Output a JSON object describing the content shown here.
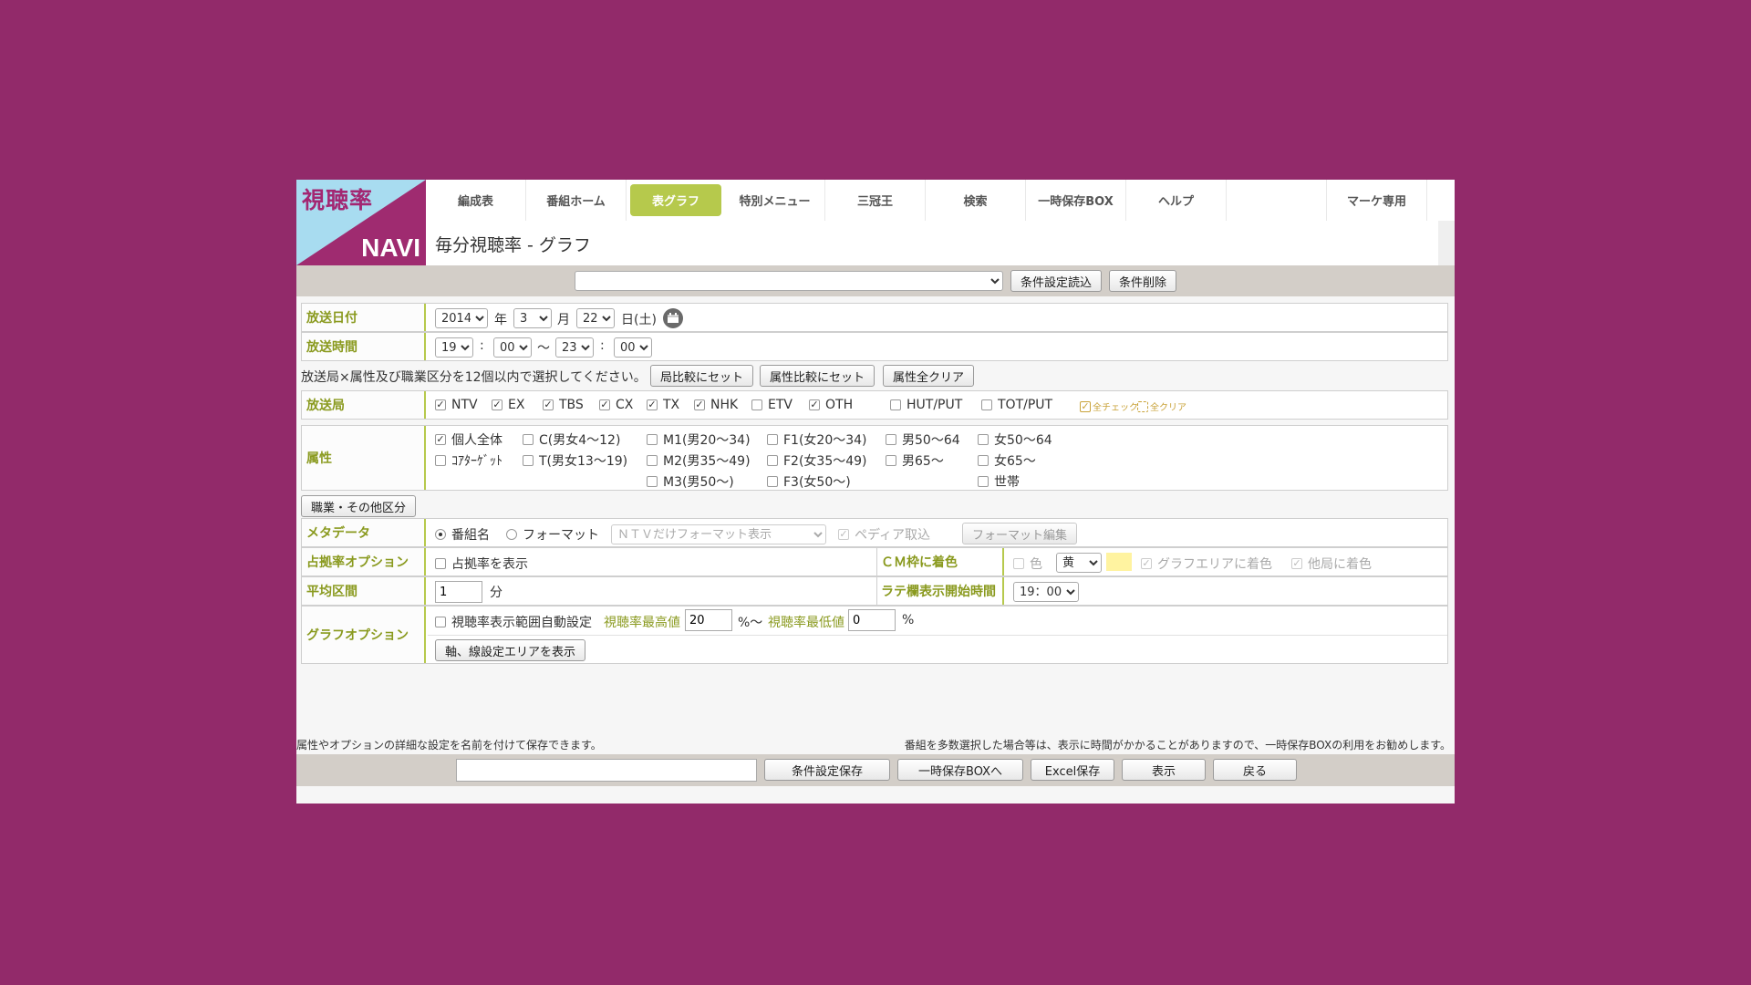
{
  "logo": {
    "top": "視聴率",
    "bottom": "NAVI"
  },
  "nav": {
    "items": [
      "編成表",
      "番組ホーム",
      "表グラフ",
      "特別メニュー",
      "三冠王",
      "検索",
      "一時保存BOX",
      "ヘルプ"
    ],
    "right": "マーケ専用",
    "active_index": 2
  },
  "page_title": "毎分視聴率 - グラフ",
  "condition": {
    "select_value": "",
    "load_label": "条件設定読込",
    "delete_label": "条件削除"
  },
  "date": {
    "label": "放送日付",
    "year": "2014",
    "year_unit": "年",
    "month": "3",
    "month_unit": "月",
    "day": "22",
    "day_unit": "日(土)"
  },
  "time": {
    "label": "放送時間",
    "sh": "19",
    "sm": "00",
    "tilde": "〜",
    "eh": "23",
    "em": "00",
    "colon": ":"
  },
  "instruction": {
    "text": "放送局×属性及び職業区分を12個以内で選択してください。",
    "btn1": "局比較にセット",
    "btn2": "属性比較にセット",
    "btn3": "属性全クリア"
  },
  "stations": {
    "label": "放送局",
    "items": [
      {
        "name": "NTV",
        "checked": true
      },
      {
        "name": "EX",
        "checked": true
      },
      {
        "name": "TBS",
        "checked": true
      },
      {
        "name": "CX",
        "checked": true
      },
      {
        "name": "TX",
        "checked": true
      },
      {
        "name": "NHK",
        "checked": true
      },
      {
        "name": "ETV",
        "checked": false
      },
      {
        "name": "OTH",
        "checked": true
      },
      {
        "name": "HUT/PUT",
        "checked": false
      },
      {
        "name": "TOT/PUT",
        "checked": false
      }
    ],
    "check_all": "全チェック",
    "clear_all": "全クリア"
  },
  "attributes": {
    "label": "属性",
    "col1": [
      {
        "name": "個人全体",
        "checked": true
      },
      {
        "name": "ｺｱﾀｰｹﾞｯﾄ",
        "checked": false
      }
    ],
    "col2": [
      {
        "name": "C(男女4〜12)",
        "checked": false
      },
      {
        "name": "T(男女13〜19)",
        "checked": false
      }
    ],
    "col3": [
      {
        "name": "M1(男20〜34)",
        "checked": false
      },
      {
        "name": "M2(男35〜49)",
        "checked": false
      },
      {
        "name": "M3(男50〜)",
        "checked": false
      }
    ],
    "col4": [
      {
        "name": "F1(女20〜34)",
        "checked": false
      },
      {
        "name": "F2(女35〜49)",
        "checked": false
      },
      {
        "name": "F3(女50〜)",
        "checked": false
      }
    ],
    "col5": [
      {
        "name": "男50〜64",
        "checked": false
      },
      {
        "name": "男65〜",
        "checked": false
      }
    ],
    "col6": [
      {
        "name": "女50〜64",
        "checked": false
      },
      {
        "name": "女65〜",
        "checked": false
      },
      {
        "name": "世帯",
        "checked": false
      }
    ]
  },
  "occupation_button": "職業・その他区分",
  "metadata": {
    "label": "メタデータ",
    "opt1": "番組名",
    "opt2": "フォーマット",
    "format_select": "ＮＴＶだけフォーマット表示",
    "wiki": "ペディア取込",
    "format_edit": "フォーマット編集"
  },
  "share": {
    "label": "占拠率オプション",
    "check": "占拠率を表示"
  },
  "cm": {
    "label": "ＣＭ枠に着色",
    "color_label": "色",
    "color_value": "黄",
    "swatch_color": "#fff3a0",
    "graph_area": "グラフエリアに着色",
    "other_station": "他局に着色"
  },
  "average": {
    "label": "平均区間",
    "value": "1",
    "unit": "分"
  },
  "rate_start": {
    "label": "ラテ欄表示開始時間",
    "value": "19：00"
  },
  "graph_options": {
    "label": "グラフオプション",
    "auto": "視聴率表示範囲自動設定",
    "max_label": "視聴率最高値",
    "max_value": "20",
    "max_unit": "%〜",
    "min_label": "視聴率最低値",
    "min_value": "0",
    "min_unit": "%",
    "axis_button": "軸、線設定エリアを表示"
  },
  "footer": {
    "note_left": "属性やオプションの詳細な設定を名前を付けて保存できます。",
    "note_right": "番組を多数選択した場合等は、表示に時間がかかることがありますので、一時保存BOXの利用をお勧めします。",
    "save_name": "",
    "save": "条件設定保存",
    "to_box": "一時保存BOXへ",
    "excel": "Excel保存",
    "show": "表示",
    "back": "戻る"
  },
  "colors": {
    "accent": "#b6c94c",
    "label": "#8a9a1f",
    "background": "#922a6a",
    "logo_blue": "#a8dcf0",
    "logo_magenta": "#a32772"
  }
}
